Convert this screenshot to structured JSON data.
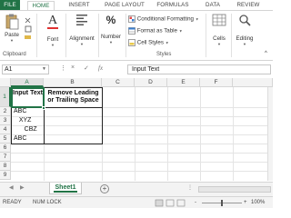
{
  "ribbon": {
    "tabs": [
      "FILE",
      "HOME",
      "INSERT",
      "PAGE LAYOUT",
      "FORMULAS",
      "DATA",
      "REVIEW"
    ],
    "active_tab": "HOME",
    "paste_label": "Paste",
    "clipboard_label": "Clipboard",
    "font_label": "Font",
    "alignment_label": "Alignment",
    "number_label": "Number",
    "conditional_formatting_label": "Conditional Formatting",
    "format_as_table_label": "Format as Table",
    "cell_styles_label": "Cell Styles",
    "styles_label": "Styles",
    "cells_label": "Cells",
    "editing_label": "Editing",
    "percent_symbol": "%",
    "font_symbol": "A"
  },
  "formula_bar": {
    "name_box": "A1",
    "cancel_symbol": "×",
    "enter_symbol": "✓",
    "fx_symbol": "fx",
    "content": "Input Text"
  },
  "grid": {
    "columns": [
      "A",
      "B",
      "C",
      "D",
      "E",
      "F"
    ],
    "rows": [
      "1",
      "2",
      "3",
      "4",
      "5",
      "6",
      "7",
      "8",
      "9",
      "10"
    ],
    "header_a": "Input Text",
    "header_b": "Remove Leading or Trailing Space",
    "a2": "ABC",
    "a3": "   XYZ",
    "a4": "      CBZ",
    "a5": "ABC"
  },
  "sheets": {
    "active": "Sheet1",
    "add_symbol": "+"
  },
  "status": {
    "ready": "READY",
    "num_lock": "NUM LOCK",
    "zoom": "100%",
    "zoom_minus": "-",
    "zoom_plus": "+"
  },
  "colors": {
    "accent": "#217346"
  }
}
